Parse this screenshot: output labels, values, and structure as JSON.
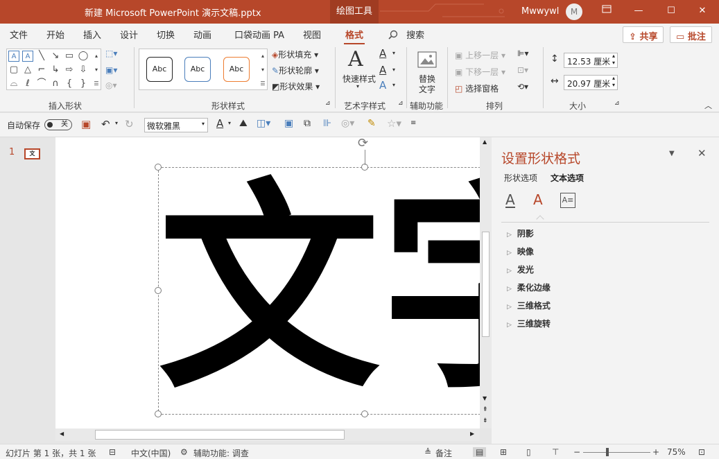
{
  "titlebar": {
    "document": "新建 Microsoft PowerPoint 演示文稿.pptx",
    "context_tab": "绘图工具",
    "user": "Mwwywl",
    "avatar": "M"
  },
  "tabs": [
    "文件",
    "开始",
    "插入",
    "设计",
    "切换",
    "动画",
    "口袋动画 PA",
    "视图",
    "格式"
  ],
  "active_tab": "格式",
  "search": "搜索",
  "share": "共享",
  "comment": "批注",
  "ribbon": {
    "groups": {
      "insert_shapes": "插入形状",
      "shape_styles": "形状样式",
      "wordart": "艺术字样式",
      "accessibility": "辅助功能",
      "arrange": "排列",
      "size": "大小"
    },
    "style_samples": [
      "Abc",
      "Abc",
      "Abc"
    ],
    "shape_fill": "形状填充",
    "shape_outline": "形状轮廓",
    "shape_effects": "形状效果",
    "quick_styles": "快速样式",
    "alt_text_1": "替换",
    "alt_text_2": "文字",
    "bring_forward": "上移一层",
    "send_backward": "下移一层",
    "selection_pane": "选择窗格",
    "height": "12.53 厘米",
    "width": "20.97 厘米"
  },
  "qat": {
    "autosave": "自动保存",
    "toggle": "关",
    "font": "微软雅黑"
  },
  "slide": {
    "number": "1",
    "text": "文字"
  },
  "pane": {
    "title": "设置形状格式",
    "tab_shape": "形状选项",
    "tab_text": "文本选项",
    "sections": [
      "阴影",
      "映像",
      "发光",
      "柔化边缘",
      "三维格式",
      "三维旋转"
    ]
  },
  "status": {
    "slide_info": "幻灯片 第 1 张，共 1 张",
    "language": "中文(中国)",
    "accessibility": "辅助功能: 调查",
    "notes": "备注",
    "zoom": "75%"
  },
  "colors": {
    "accent": "#b7472a"
  }
}
